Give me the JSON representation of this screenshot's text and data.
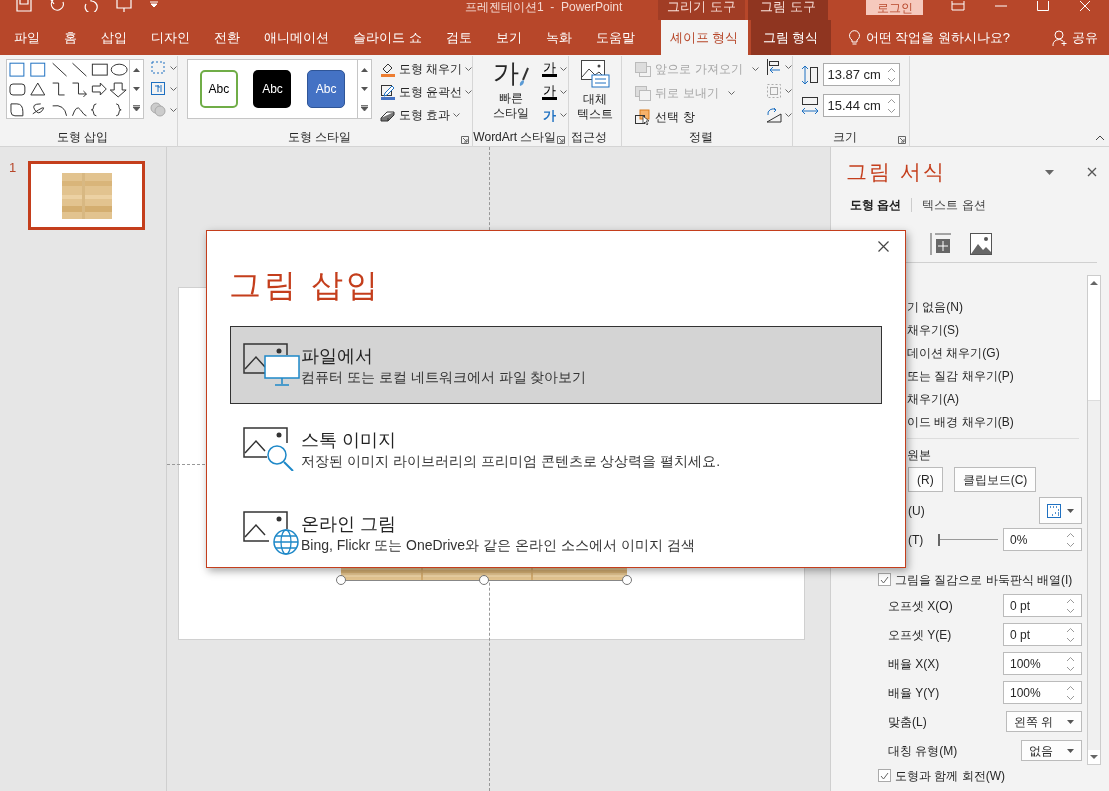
{
  "title_bar": {
    "title": "프레젠테이션1  -  PowerPoint",
    "context_tabs": [
      "그리기 도구",
      "그림 도구"
    ],
    "sign_in": "로그인"
  },
  "tabs": [
    {
      "label": "파일",
      "kind": "main",
      "selected": false
    },
    {
      "label": "홈",
      "kind": "main",
      "selected": false
    },
    {
      "label": "삽입",
      "kind": "main",
      "selected": false
    },
    {
      "label": "디자인",
      "kind": "main",
      "selected": false
    },
    {
      "label": "전환",
      "kind": "main",
      "selected": false
    },
    {
      "label": "애니메이션",
      "kind": "main",
      "selected": false
    },
    {
      "label": "슬라이드 쇼",
      "kind": "main",
      "selected": false
    },
    {
      "label": "검토",
      "kind": "main",
      "selected": false
    },
    {
      "label": "보기",
      "kind": "main",
      "selected": false
    },
    {
      "label": "녹화",
      "kind": "main",
      "selected": false
    },
    {
      "label": "도움말",
      "kind": "main",
      "selected": false
    },
    {
      "label": "셰이프 형식",
      "kind": "drawing",
      "selected": true
    },
    {
      "label": "그림 형식",
      "kind": "picture",
      "selected": false
    }
  ],
  "tell_me": "어떤 작업을 원하시나요?",
  "share": "공유",
  "ribbon": {
    "insert_shapes": {
      "label": "도형 삽입"
    },
    "shape_styles": {
      "label": "도형 스타일",
      "presets": [
        {
          "text": "Abc",
          "kind": "outline"
        },
        {
          "text": "Abc",
          "kind": "dark"
        },
        {
          "text": "Abc",
          "kind": "blue"
        }
      ],
      "commands": [
        "도형 채우기",
        "도형 윤곽선",
        "도형 효과"
      ]
    },
    "wordart": {
      "label": "WordArt 스타일",
      "quick_styles": "빠른 스타일",
      "big_glyph": "가",
      "glyphs": [
        {
          "text": "가",
          "kind": "fill"
        },
        {
          "text": "가",
          "kind": "outline"
        },
        {
          "text": "가",
          "kind": "effect"
        }
      ]
    },
    "accessibility": {
      "label": "접근성",
      "alt_text": "대체 텍스트"
    },
    "arrange": {
      "label": "정렬",
      "commands": [
        {
          "label": "앞으로 가져오기",
          "disabled": true
        },
        {
          "label": "뒤로 보내기",
          "disabled": true
        },
        {
          "label": "선택 창",
          "disabled": false
        }
      ]
    },
    "size": {
      "label": "크기",
      "height": "13.87 cm",
      "width": "15.44 cm"
    }
  },
  "slides": [
    {
      "number": "1",
      "selected": true
    }
  ],
  "dialog": {
    "title": "그림 삽입",
    "options": [
      {
        "kind": "file",
        "title": "파일에서",
        "description": "컴퓨터 또는 로컬 네트워크에서 파일 찾아보기",
        "selected": true
      },
      {
        "kind": "stock",
        "title": "스톡 이미지",
        "description": "저장된 이미지 라이브러리의 프리미엄 콘텐츠로 상상력을 펼치세요.",
        "selected": false
      },
      {
        "kind": "online",
        "title": "온라인 그림",
        "description": "Bing, Flickr 또는 OneDrive와 같은 온라인 소스에서 이미지 검색",
        "selected": false
      }
    ]
  },
  "format_pane": {
    "title": "그림 서식",
    "tabs": [
      {
        "label": "도형 옵션",
        "selected": true
      },
      {
        "label": "텍스트 옵션",
        "selected": false
      }
    ],
    "fill_options": [
      "기 없음(N)",
      "채우기(S)",
      "데이션 채우기(G)",
      "또는 질감 채우기(P)",
      "채우기(A)",
      "이드 배경 채우기(B)"
    ],
    "source_label": "원본",
    "source_buttons": [
      "(R)",
      "클립보드(C)"
    ],
    "texture_label": "(U)",
    "transparency": {
      "label": "(T)",
      "value": "0%",
      "level": 0
    },
    "tile": {
      "label": "그림을 질감으로 바둑판식 배열(I)",
      "checked": true
    },
    "fields": [
      {
        "label": "오프셋 X(O)",
        "value": "0 pt",
        "kind": "spin"
      },
      {
        "label": "오프셋 Y(E)",
        "value": "0 pt",
        "kind": "spin"
      },
      {
        "label": "배율 X(X)",
        "value": "100%",
        "kind": "spin"
      },
      {
        "label": "배율 Y(Y)",
        "value": "100%",
        "kind": "spin"
      },
      {
        "label": "맞춤(L)",
        "value": "왼쪽 위",
        "kind": "dropdown"
      },
      {
        "label": "대칭 유형(M)",
        "value": "없음",
        "kind": "dropdown"
      }
    ],
    "rotate": {
      "label": "도형과 함께 회전(W)",
      "checked": true
    }
  }
}
